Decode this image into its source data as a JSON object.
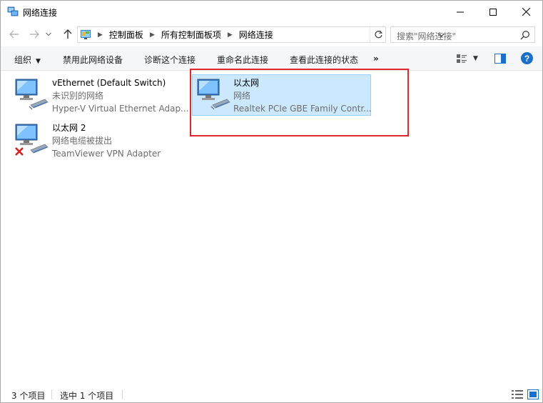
{
  "window": {
    "title": "网络连接",
    "icons": {
      "app": "network-connections-icon",
      "minimize": "minimize-icon",
      "maximize": "maximize-icon",
      "close": "close-icon"
    }
  },
  "nav": {
    "back_icon": "arrow-left-icon",
    "forward_icon": "arrow-right-icon",
    "recent_icon": "chevron-down-icon",
    "up_icon": "arrow-up-icon",
    "breadcrumb": [
      "控制面板",
      "所有控制面板项",
      "网络连接"
    ],
    "refresh_icon": "refresh-icon",
    "search_placeholder": "搜索\"网络连接\""
  },
  "commands": {
    "organize": "组织",
    "disable": "禁用此网络设备",
    "diagnose": "诊断这个连接",
    "rename": "重命名此连接",
    "status": "查看此连接的状态",
    "more": "»"
  },
  "connections": [
    {
      "name": "vEthernet (Default Switch)",
      "status": "未识别的网络",
      "device": "Hyper-V Virtual Ethernet Adap...",
      "selected": false,
      "disconnected": false
    },
    {
      "name": "以太网",
      "status": "网络",
      "device": "Realtek PCIe GBE Family Contr...",
      "selected": true,
      "disconnected": false
    },
    {
      "name": "以太网 2",
      "status": "网络电缆被拔出",
      "device": "TeamViewer VPN Adapter",
      "selected": false,
      "disconnected": true
    }
  ],
  "statusbar": {
    "count": "3 个项目",
    "selected": "选中 1 个项目"
  },
  "colors": {
    "selection_bg": "#cce8ff",
    "selection_border": "#99d1ff",
    "highlight": "#e0262f",
    "help_blue": "#1a6fc9"
  }
}
